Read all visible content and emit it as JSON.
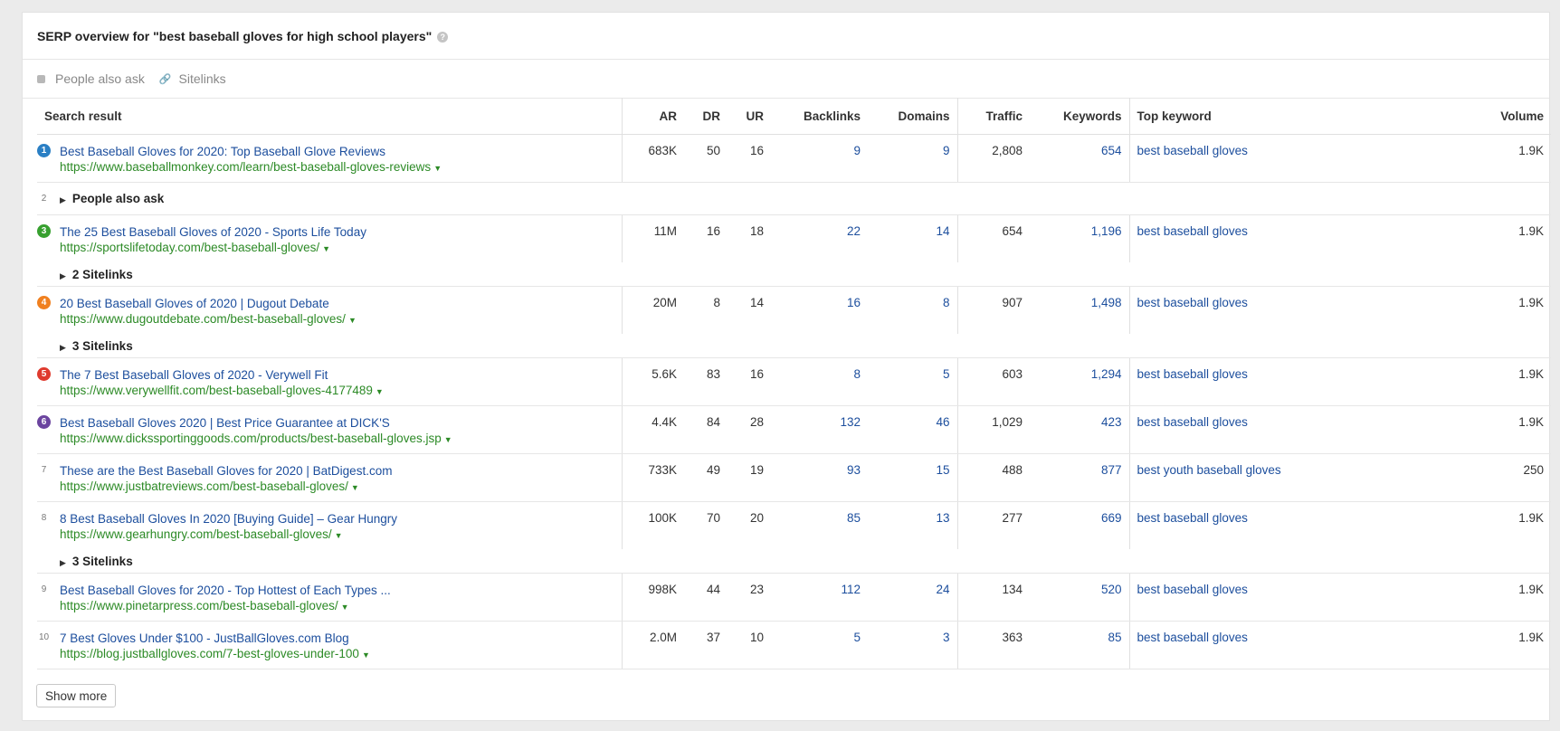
{
  "header": {
    "title": "SERP overview for \"best baseball gloves for high school players\"",
    "help": "?"
  },
  "filters": {
    "people_also_ask": "People also ask",
    "sitelinks": "Sitelinks"
  },
  "columns": {
    "search_result": "Search result",
    "ar": "AR",
    "dr": "DR",
    "ur": "UR",
    "backlinks": "Backlinks",
    "domains": "Domains",
    "traffic": "Traffic",
    "keywords": "Keywords",
    "top_keyword": "Top keyword",
    "volume": "Volume"
  },
  "colors": {
    "link": "#1c4e9d",
    "url": "#2c8a26",
    "pos1": "#2a7fc4",
    "pos3": "#37a02f",
    "pos4": "#f0801f",
    "pos5": "#df3a2e",
    "pos6": "#6b449f"
  },
  "rows": {
    "r1": {
      "pos": "1",
      "title": "Best Baseball Gloves for 2020: Top Baseball Glove Reviews",
      "url": "https://www.baseballmonkey.com/learn/best-baseball-gloves-reviews",
      "ar": "683K",
      "dr": "50",
      "ur": "16",
      "backlinks": "9",
      "domains": "9",
      "traffic": "2,808",
      "keywords": "654",
      "top_keyword": "best baseball gloves",
      "volume": "1.9K"
    },
    "paa": {
      "pos": "2",
      "label": "People also ask"
    },
    "r3": {
      "pos": "3",
      "title": "The 25 Best Baseball Gloves of 2020 - Sports Life Today",
      "url": "https://sportslifetoday.com/best-baseball-gloves/",
      "ar": "11M",
      "dr": "16",
      "ur": "18",
      "backlinks": "22",
      "domains": "14",
      "traffic": "654",
      "keywords": "1,196",
      "top_keyword": "best baseball gloves",
      "volume": "1.9K",
      "sitelinks": "2 Sitelinks"
    },
    "r4": {
      "pos": "4",
      "title": "20 Best Baseball Gloves of 2020 | Dugout Debate",
      "url": "https://www.dugoutdebate.com/best-baseball-gloves/",
      "ar": "20M",
      "dr": "8",
      "ur": "14",
      "backlinks": "16",
      "domains": "8",
      "traffic": "907",
      "keywords": "1,498",
      "top_keyword": "best baseball gloves",
      "volume": "1.9K",
      "sitelinks": "3 Sitelinks"
    },
    "r5": {
      "pos": "5",
      "title": "The 7 Best Baseball Gloves of 2020 - Verywell Fit",
      "url": "https://www.verywellfit.com/best-baseball-gloves-4177489",
      "ar": "5.6K",
      "dr": "83",
      "ur": "16",
      "backlinks": "8",
      "domains": "5",
      "traffic": "603",
      "keywords": "1,294",
      "top_keyword": "best baseball gloves",
      "volume": "1.9K"
    },
    "r6": {
      "pos": "6",
      "title": "Best Baseball Gloves 2020 | Best Price Guarantee at DICK'S",
      "url": "https://www.dickssportinggoods.com/products/best-baseball-gloves.jsp",
      "ar": "4.4K",
      "dr": "84",
      "ur": "28",
      "backlinks": "132",
      "domains": "46",
      "traffic": "1,029",
      "keywords": "423",
      "top_keyword": "best baseball gloves",
      "volume": "1.9K"
    },
    "r7": {
      "pos": "7",
      "title": "These are the Best Baseball Gloves for 2020 | BatDigest.com",
      "url": "https://www.justbatreviews.com/best-baseball-gloves/",
      "ar": "733K",
      "dr": "49",
      "ur": "19",
      "backlinks": "93",
      "domains": "15",
      "traffic": "488",
      "keywords": "877",
      "top_keyword": "best youth baseball gloves",
      "volume": "250"
    },
    "r8": {
      "pos": "8",
      "title": "8 Best Baseball Gloves In 2020 [Buying Guide] – Gear Hungry",
      "url": "https://www.gearhungry.com/best-baseball-gloves/",
      "ar": "100K",
      "dr": "70",
      "ur": "20",
      "backlinks": "85",
      "domains": "13",
      "traffic": "277",
      "keywords": "669",
      "top_keyword": "best baseball gloves",
      "volume": "1.9K",
      "sitelinks": "3 Sitelinks"
    },
    "r9": {
      "pos": "9",
      "title": "Best Baseball Gloves for 2020 - Top Hottest of Each Types ...",
      "url": "https://www.pinetarpress.com/best-baseball-gloves/",
      "ar": "998K",
      "dr": "44",
      "ur": "23",
      "backlinks": "112",
      "domains": "24",
      "traffic": "134",
      "keywords": "520",
      "top_keyword": "best baseball gloves",
      "volume": "1.9K"
    },
    "r10": {
      "pos": "10",
      "title": "7 Best Gloves Under $100 - JustBallGloves.com Blog",
      "url": "https://blog.justballgloves.com/7-best-gloves-under-100",
      "ar": "2.0M",
      "dr": "37",
      "ur": "10",
      "backlinks": "5",
      "domains": "3",
      "traffic": "363",
      "keywords": "85",
      "top_keyword": "best baseball gloves",
      "volume": "1.9K"
    }
  },
  "show_more": "Show more"
}
